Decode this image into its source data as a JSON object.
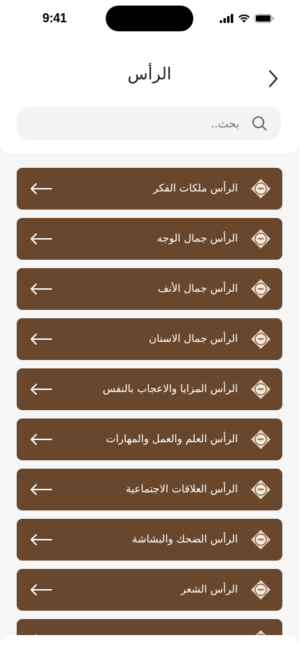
{
  "status_bar": {
    "time": "9:41",
    "icons": [
      "cellular-icon",
      "wifi-icon",
      "battery-icon"
    ]
  },
  "header": {
    "title": "الرأس",
    "back_icon": "chevron-right-icon"
  },
  "search": {
    "placeholder": "بحث..",
    "value": "",
    "icon": "search-icon"
  },
  "list": {
    "items": [
      {
        "label": "الرأس ملكات الفكر"
      },
      {
        "label": "الرأس جمال الوجه"
      },
      {
        "label": "الرأس جمال الأنف"
      },
      {
        "label": "الرأس جمال الاسنان"
      },
      {
        "label": "الرأس المزايا والاعجاب بالنفس"
      },
      {
        "label": "الرأس العلم والعمل والمهارات"
      },
      {
        "label": "الرأس العلاقات الاجتماعية"
      },
      {
        "label": "الرأس الضحك والبشاشة"
      },
      {
        "label": "الرأس الشعر"
      },
      {
        "label": ""
      }
    ],
    "item_icon": "ornament-badge-icon",
    "arrow_icon": "arrow-left-icon"
  },
  "colors": {
    "item_background": "#69472c",
    "badge_fill": "#e9d9c4",
    "page_background": "#f6f6f7"
  }
}
